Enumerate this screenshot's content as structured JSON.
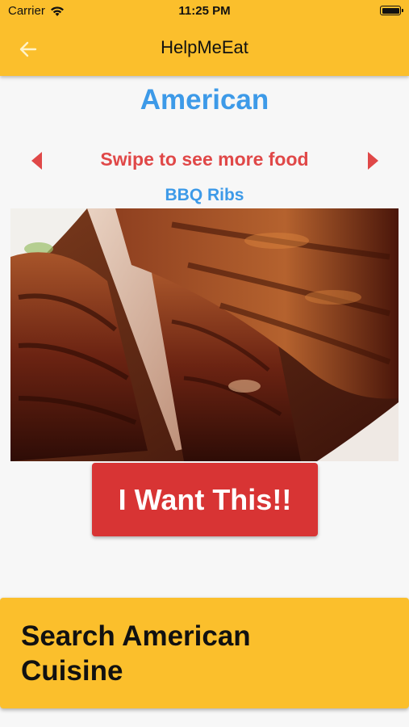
{
  "status_bar": {
    "carrier": "Carrier",
    "time": "11:25 PM"
  },
  "app_bar": {
    "title": "HelpMeEat",
    "back_icon": "back-arrow-icon",
    "accent_color": "#fbbf2c"
  },
  "main": {
    "cuisine": "American",
    "swipe_hint": "Swipe to see more food",
    "dish_name": "BBQ Ribs",
    "photo_subject": "barbecued pork ribs",
    "want_button": "I Want This!!"
  },
  "search": {
    "label": "Search American Cuisine"
  },
  "colors": {
    "title_blue": "#3d9ae8",
    "hint_red": "#e04848",
    "button_red": "#d83434",
    "header_yellow": "#fbbf2c"
  }
}
